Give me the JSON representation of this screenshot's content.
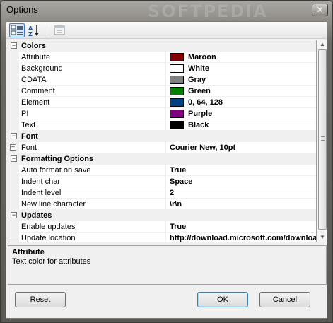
{
  "window": {
    "title": "Options",
    "watermark": "SOFTPEDIA",
    "close": "✕"
  },
  "toolbar": {
    "categorized_icon": "categorized-icon",
    "alphabetical_icon": "alphabetical-sort-icon",
    "property_pages_icon": "property-pages-icon"
  },
  "grid": {
    "colors": {
      "label": "Colors",
      "items": [
        {
          "name": "Attribute",
          "value": "Maroon",
          "swatch": "#800000"
        },
        {
          "name": "Background",
          "value": "White",
          "swatch": "#ffffff"
        },
        {
          "name": "CDATA",
          "value": "Gray",
          "swatch": "#808080"
        },
        {
          "name": "Comment",
          "value": "Green",
          "swatch": "#008000"
        },
        {
          "name": "Element",
          "value": "0, 64, 128",
          "swatch": "#004080"
        },
        {
          "name": "PI",
          "value": "Purple",
          "swatch": "#800080"
        },
        {
          "name": "Text",
          "value": "Black",
          "swatch": "#000000"
        }
      ]
    },
    "font": {
      "label": "Font",
      "items": [
        {
          "name": "Font",
          "value": "Courier New, 10pt"
        }
      ]
    },
    "formatting": {
      "label": "Formatting Options",
      "items": [
        {
          "name": "Auto format on save",
          "value": "True"
        },
        {
          "name": "Indent char",
          "value": "Space"
        },
        {
          "name": "Indent level",
          "value": "2"
        },
        {
          "name": "New line character",
          "value": "\\r\\n"
        }
      ]
    },
    "updates": {
      "label": "Updates",
      "items": [
        {
          "name": "Enable updates",
          "value": "True"
        },
        {
          "name": "Update location",
          "value": "http://download.microsoft.com/download"
        }
      ]
    }
  },
  "description": {
    "title": "Attribute",
    "text": "Text color for attributes"
  },
  "buttons": {
    "reset": "Reset",
    "ok": "OK",
    "cancel": "Cancel"
  }
}
